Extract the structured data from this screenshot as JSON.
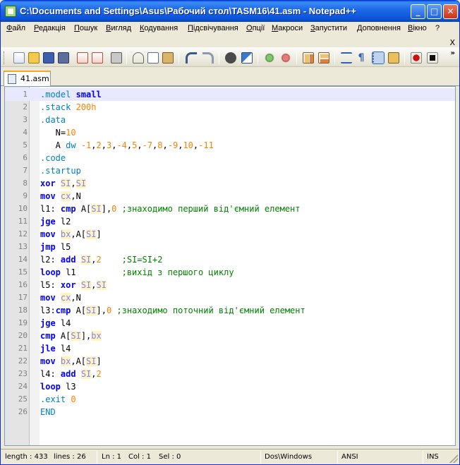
{
  "window": {
    "title": "C:\\Documents and Settings\\Asus\\Рабочий стол\\TASM16\\41.asm - Notepad++",
    "minimize_glyph": "_",
    "maximize_glyph": "□",
    "close_glyph": "✕"
  },
  "menu": {
    "items": [
      "Файл",
      "Редакція",
      "Пошук",
      "Вигляд",
      "Кодування",
      "Підсвічування",
      "Опції",
      "Макроси",
      "Запустити",
      "Доповнення",
      "Вікно",
      "?"
    ],
    "close_doc": "X"
  },
  "toolbar": {
    "icons": [
      "new-file-icon",
      "open-file-icon",
      "save-icon",
      "save-all-icon",
      "close-icon",
      "close-all-icon",
      "print-icon",
      "cut-icon",
      "copy-icon",
      "paste-icon",
      "undo-icon",
      "redo-icon",
      "find-icon",
      "replace-icon",
      "zoom-in-icon",
      "zoom-out-icon",
      "sync-vertical-icon",
      "sync-horizontal-icon",
      "word-wrap-icon",
      "show-all-chars-icon",
      "indent-guide-icon",
      "user-language-icon",
      "record-macro-icon",
      "stop-macro-icon"
    ],
    "overflow": "»"
  },
  "tabs": [
    {
      "label": "41.asm",
      "active": true
    }
  ],
  "editor": {
    "current_line": 1,
    "lines": [
      [
        [
          "dir",
          ".model "
        ],
        [
          "kw",
          "small"
        ]
      ],
      [
        [
          "dir",
          ".stack "
        ],
        [
          "num",
          "200h"
        ]
      ],
      [
        [
          "dir",
          ".data"
        ]
      ],
      [
        [
          "plain",
          "   N="
        ],
        [
          "num",
          "10"
        ]
      ],
      [
        [
          "plain",
          "   A "
        ],
        [
          "dir",
          "dw "
        ],
        [
          "num",
          "-1"
        ],
        [
          "plain",
          ","
        ],
        [
          "num",
          "2"
        ],
        [
          "plain",
          ","
        ],
        [
          "num",
          "3"
        ],
        [
          "plain",
          ","
        ],
        [
          "num",
          "-4"
        ],
        [
          "plain",
          ","
        ],
        [
          "num",
          "5"
        ],
        [
          "plain",
          ","
        ],
        [
          "num",
          "-7"
        ],
        [
          "plain",
          ","
        ],
        [
          "num",
          "8"
        ],
        [
          "plain",
          ","
        ],
        [
          "num",
          "-9"
        ],
        [
          "plain",
          ","
        ],
        [
          "num",
          "10"
        ],
        [
          "plain",
          ","
        ],
        [
          "num",
          "-11"
        ]
      ],
      [
        [
          "dir",
          ".code"
        ]
      ],
      [
        [
          "dir",
          ".startup"
        ]
      ],
      [
        [
          "kw",
          "xor "
        ],
        [
          "reg",
          "SI"
        ],
        [
          "plain",
          ","
        ],
        [
          "reg",
          "SI"
        ]
      ],
      [
        [
          "kw",
          "mov "
        ],
        [
          "reg",
          "cx"
        ],
        [
          "plain",
          ",N"
        ]
      ],
      [
        [
          "plain",
          "l1: "
        ],
        [
          "kw",
          "cmp "
        ],
        [
          "plain",
          "A["
        ],
        [
          "reg",
          "SI"
        ],
        [
          "plain",
          "],"
        ],
        [
          "num",
          "0"
        ],
        [
          "cmt",
          " ;знаходимо перший від'ємний елемент"
        ]
      ],
      [
        [
          "kw",
          "jge "
        ],
        [
          "plain",
          "l2"
        ]
      ],
      [
        [
          "kw",
          "mov "
        ],
        [
          "reg",
          "bx"
        ],
        [
          "plain",
          ",A["
        ],
        [
          "reg",
          "SI"
        ],
        [
          "plain",
          "]"
        ]
      ],
      [
        [
          "kw",
          "jmp "
        ],
        [
          "plain",
          "l5"
        ]
      ],
      [
        [
          "plain",
          "l2: "
        ],
        [
          "kw",
          "add "
        ],
        [
          "reg",
          "SI"
        ],
        [
          "plain",
          ","
        ],
        [
          "num",
          "2"
        ],
        [
          "cmt",
          "    ;SI=SI+2"
        ]
      ],
      [
        [
          "kw",
          "loop "
        ],
        [
          "plain",
          "l1"
        ],
        [
          "cmt",
          "         ;вихід з першого циклу"
        ]
      ],
      [
        [
          "plain",
          "l5: "
        ],
        [
          "kw",
          "xor "
        ],
        [
          "reg",
          "SI"
        ],
        [
          "plain",
          ","
        ],
        [
          "reg",
          "SI"
        ]
      ],
      [
        [
          "kw",
          "mov "
        ],
        [
          "reg",
          "cx"
        ],
        [
          "plain",
          ",N"
        ]
      ],
      [
        [
          "plain",
          "l3:"
        ],
        [
          "kw",
          "cmp "
        ],
        [
          "plain",
          "A["
        ],
        [
          "reg",
          "SI"
        ],
        [
          "plain",
          "],"
        ],
        [
          "num",
          "0"
        ],
        [
          "cmt",
          " ;знаходимо поточний від'ємний елемент"
        ]
      ],
      [
        [
          "kw",
          "jge "
        ],
        [
          "plain",
          "l4"
        ]
      ],
      [
        [
          "kw",
          "cmp "
        ],
        [
          "plain",
          "A["
        ],
        [
          "reg",
          "SI"
        ],
        [
          "plain",
          "],"
        ],
        [
          "reg",
          "bx"
        ]
      ],
      [
        [
          "kw",
          "jle "
        ],
        [
          "plain",
          "l4"
        ]
      ],
      [
        [
          "kw",
          "mov "
        ],
        [
          "reg",
          "bx"
        ],
        [
          "plain",
          ",A["
        ],
        [
          "reg",
          "SI"
        ],
        [
          "plain",
          "]"
        ]
      ],
      [
        [
          "plain",
          "l4: "
        ],
        [
          "kw",
          "add "
        ],
        [
          "reg",
          "SI"
        ],
        [
          "plain",
          ","
        ],
        [
          "num",
          "2"
        ]
      ],
      [
        [
          "kw",
          "loop "
        ],
        [
          "plain",
          "l3"
        ]
      ],
      [
        [
          "dir",
          ".exit "
        ],
        [
          "num",
          "0"
        ]
      ],
      [
        [
          "dir",
          "END"
        ]
      ]
    ]
  },
  "status": {
    "length": "length : 433",
    "lines": "lines : 26",
    "ln": "Ln : 1",
    "col": "Col : 1",
    "sel": "Sel : 0",
    "eol": "Dos\\Windows",
    "encoding": "ANSI",
    "mode": "INS"
  },
  "colors": {
    "keyword": "#0000ff",
    "directive": "#0080c0",
    "number": "#ff8000",
    "register": "#8080ff",
    "comment": "#008000",
    "current_line": "#e8e8ff"
  }
}
